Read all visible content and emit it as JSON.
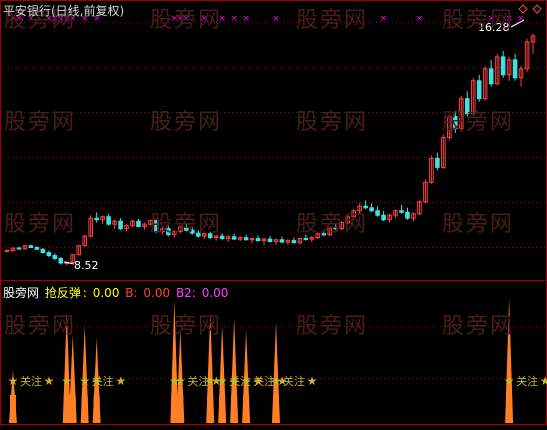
{
  "main_chart": {
    "title": "平安银行(日线,前复权)",
    "price_high_label": "16.28",
    "price_low_label": "8.52"
  },
  "indicator": {
    "watermark_label": "股旁网",
    "name": "抢反弹",
    "value": "0.00",
    "b_label": "B:",
    "b_value": "0.00",
    "b2_label": "B2:",
    "b2_value": "0.00",
    "signal_text": "关注",
    "signal_star": "★"
  },
  "watermarks": [
    "股旁网",
    "股旁网",
    "股旁网",
    "股旁网",
    "股旁网",
    "股旁网",
    "股旁网",
    "股旁网",
    "股旁网",
    "股旁网",
    "股旁网",
    "股旁网",
    "股旁网",
    "股旁网",
    "股旁网",
    "股旁网"
  ],
  "colors": {
    "up_candle": "#ff4040",
    "down_candle": "#40e0e0",
    "grid": "#a00000",
    "marker": "#ff00ff",
    "spike": "#ff7f27",
    "signal": "#c8b432",
    "b_label": "#ff4040",
    "b2_label": "#ff40ff",
    "indicator_name": "#ffff00",
    "white": "#ffffff"
  },
  "chart_data": {
    "type": "candlestick",
    "title": "平安银行(日线,前复权)",
    "ylim": [
      8.3,
      16.6
    ],
    "price_low": 8.52,
    "price_high": 16.28,
    "ohlc": [
      [
        9.0,
        9.05,
        8.95,
        9.02
      ],
      [
        9.02,
        9.12,
        8.98,
        9.1
      ],
      [
        9.1,
        9.15,
        9.05,
        9.08
      ],
      [
        9.08,
        9.2,
        9.04,
        9.18
      ],
      [
        9.18,
        9.22,
        9.1,
        9.12
      ],
      [
        9.12,
        9.16,
        9.04,
        9.06
      ],
      [
        9.06,
        9.1,
        8.92,
        8.95
      ],
      [
        8.95,
        9.02,
        8.8,
        8.85
      ],
      [
        8.85,
        8.92,
        8.7,
        8.75
      ],
      [
        8.75,
        8.8,
        8.55,
        8.6
      ],
      [
        8.6,
        8.68,
        8.52,
        8.62
      ],
      [
        8.62,
        8.9,
        8.6,
        8.88
      ],
      [
        8.88,
        9.2,
        8.85,
        9.18
      ],
      [
        9.18,
        9.55,
        9.15,
        9.5
      ],
      [
        9.5,
        10.2,
        9.45,
        10.1
      ],
      [
        10.1,
        10.3,
        9.95,
        10.05
      ],
      [
        10.05,
        10.2,
        9.9,
        10.15
      ],
      [
        10.15,
        10.25,
        9.85,
        9.9
      ],
      [
        9.9,
        10.05,
        9.75,
        10.0
      ],
      [
        10.0,
        10.1,
        9.7,
        9.75
      ],
      [
        9.75,
        9.9,
        9.65,
        9.85
      ],
      [
        9.85,
        10.05,
        9.8,
        10.0
      ],
      [
        10.0,
        10.08,
        9.8,
        9.82
      ],
      [
        9.82,
        9.95,
        9.72,
        9.9
      ],
      [
        9.9,
        10.05,
        9.85,
        10.02
      ],
      [
        10.02,
        10.1,
        9.6,
        9.65
      ],
      [
        9.65,
        9.8,
        9.55,
        9.75
      ],
      [
        9.75,
        9.85,
        9.5,
        9.55
      ],
      [
        9.55,
        9.7,
        9.45,
        9.65
      ],
      [
        9.65,
        9.85,
        9.6,
        9.8
      ],
      [
        9.8,
        9.92,
        9.65,
        9.7
      ],
      [
        9.7,
        9.8,
        9.55,
        9.6
      ],
      [
        9.6,
        9.7,
        9.45,
        9.5
      ],
      [
        9.5,
        9.62,
        9.4,
        9.58
      ],
      [
        9.58,
        9.65,
        9.4,
        9.45
      ],
      [
        9.45,
        9.55,
        9.35,
        9.5
      ],
      [
        9.5,
        9.6,
        9.38,
        9.42
      ],
      [
        9.42,
        9.52,
        9.3,
        9.48
      ],
      [
        9.48,
        9.58,
        9.38,
        9.4
      ],
      [
        9.4,
        9.5,
        9.32,
        9.45
      ],
      [
        9.45,
        9.55,
        9.35,
        9.38
      ],
      [
        9.38,
        9.45,
        9.25,
        9.42
      ],
      [
        9.42,
        9.52,
        9.32,
        9.35
      ],
      [
        9.35,
        9.45,
        9.2,
        9.4
      ],
      [
        9.4,
        9.5,
        9.3,
        9.32
      ],
      [
        9.32,
        9.42,
        9.22,
        9.38
      ],
      [
        9.38,
        9.48,
        9.28,
        9.3
      ],
      [
        9.3,
        9.4,
        9.2,
        9.35
      ],
      [
        9.35,
        9.45,
        9.25,
        9.28
      ],
      [
        9.28,
        9.45,
        9.22,
        9.42
      ],
      [
        9.42,
        9.55,
        9.35,
        9.4
      ],
      [
        9.4,
        9.5,
        9.3,
        9.45
      ],
      [
        9.45,
        9.62,
        9.4,
        9.58
      ],
      [
        9.58,
        9.7,
        9.5,
        9.55
      ],
      [
        9.55,
        9.8,
        9.5,
        9.78
      ],
      [
        9.78,
        9.92,
        9.7,
        9.75
      ],
      [
        9.75,
        10.0,
        9.7,
        9.95
      ],
      [
        9.95,
        10.2,
        9.9,
        10.15
      ],
      [
        10.15,
        10.4,
        10.05,
        10.35
      ],
      [
        10.35,
        10.6,
        10.25,
        10.5
      ],
      [
        10.5,
        10.7,
        10.4,
        10.45
      ],
      [
        10.45,
        10.6,
        10.3,
        10.35
      ],
      [
        10.35,
        10.5,
        10.15,
        10.2
      ],
      [
        10.2,
        10.35,
        10.0,
        10.05
      ],
      [
        10.05,
        10.25,
        9.95,
        10.2
      ],
      [
        10.2,
        10.4,
        10.1,
        10.35
      ],
      [
        10.35,
        10.55,
        10.25,
        10.3
      ],
      [
        10.3,
        10.45,
        10.05,
        10.1
      ],
      [
        10.1,
        10.3,
        10.0,
        10.25
      ],
      [
        10.25,
        10.7,
        10.2,
        10.65
      ],
      [
        10.65,
        11.4,
        10.6,
        11.3
      ],
      [
        11.3,
        12.2,
        11.25,
        12.1
      ],
      [
        12.1,
        12.3,
        11.7,
        11.8
      ],
      [
        11.8,
        12.9,
        11.75,
        12.8
      ],
      [
        12.8,
        13.6,
        12.7,
        13.5
      ],
      [
        13.5,
        13.7,
        12.95,
        13.1
      ],
      [
        13.1,
        14.2,
        13.0,
        14.1
      ],
      [
        14.1,
        14.35,
        13.5,
        13.6
      ],
      [
        13.6,
        14.8,
        13.55,
        14.7
      ],
      [
        14.7,
        14.9,
        14.0,
        14.1
      ],
      [
        14.1,
        15.2,
        14.05,
        15.1
      ],
      [
        15.1,
        15.4,
        14.5,
        14.6
      ],
      [
        14.6,
        15.6,
        14.55,
        15.5
      ],
      [
        15.5,
        15.7,
        14.8,
        14.9
      ],
      [
        14.9,
        15.5,
        14.7,
        15.4
      ],
      [
        15.4,
        15.6,
        14.7,
        14.8
      ],
      [
        14.8,
        15.2,
        14.5,
        15.1
      ],
      [
        15.1,
        16.1,
        15.0,
        16.0
      ],
      [
        16.0,
        16.28,
        15.6,
        16.2
      ]
    ],
    "marker_bars": [
      1,
      2,
      4,
      7,
      8,
      9,
      10,
      11,
      13,
      15,
      28,
      29,
      30,
      33,
      36,
      38,
      40,
      45,
      63,
      69,
      81,
      84,
      86
    ],
    "signal_bars": [
      1,
      10,
      11,
      13,
      15,
      28,
      29,
      34,
      36,
      38,
      40,
      45,
      48,
      53,
      84
    ]
  }
}
